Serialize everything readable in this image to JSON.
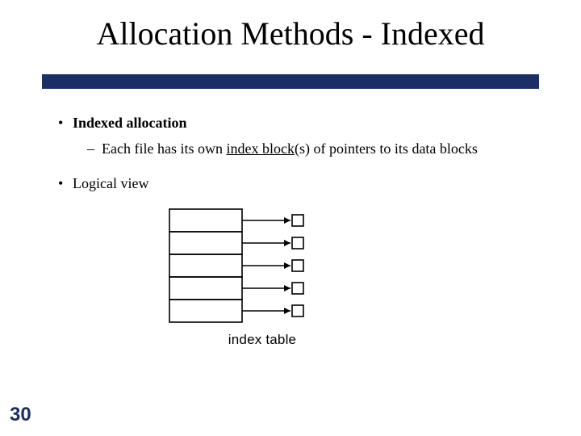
{
  "slide": {
    "title": "Allocation Methods - Indexed",
    "page_number": "30"
  },
  "bullets": {
    "b1_label": "Indexed allocation",
    "b2_prefix": "Each file has its own ",
    "b2_underlined": "index block",
    "b2_suffix": "(s) of pointers to its data blocks",
    "b3_label": "Logical view"
  },
  "diagram": {
    "caption": "index table",
    "rows": 5
  }
}
